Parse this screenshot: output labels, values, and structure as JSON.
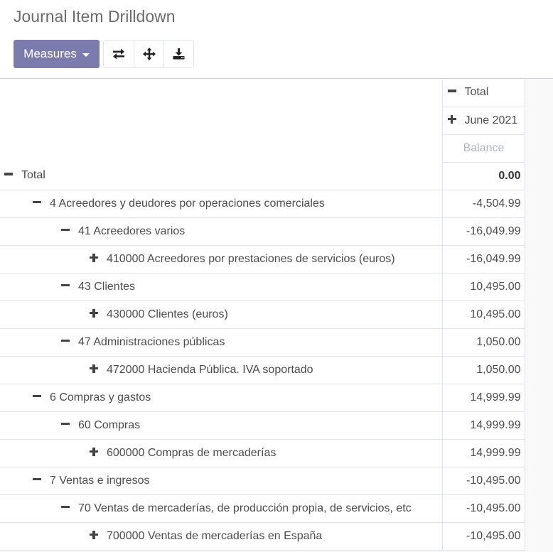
{
  "page": {
    "title": "Journal Item Drilldown"
  },
  "toolbar": {
    "measures_label": "Measures",
    "buttons": [
      {
        "icon": "exchange-icon",
        "title": "Flip axis"
      },
      {
        "icon": "arrows-icon",
        "title": "Expand all"
      },
      {
        "icon": "download-icon",
        "title": "Download xlsx"
      }
    ]
  },
  "pivot": {
    "col_headers": {
      "total": {
        "label": "Total",
        "state": "expanded"
      },
      "period": {
        "label": "June 2021",
        "state": "collapsed"
      },
      "measure": "Balance"
    },
    "rows": [
      {
        "label": "Total",
        "level": 0,
        "state": "expanded",
        "value": "0.00",
        "is_total": true
      },
      {
        "label": "4 Acreedores y deudores por operaciones comerciales",
        "level": 1,
        "state": "expanded",
        "value": "-4,504.99"
      },
      {
        "label": "41 Acreedores varios",
        "level": 2,
        "state": "expanded",
        "value": "-16,049.99"
      },
      {
        "label": "410000 Acreedores por prestaciones de servicios (euros)",
        "level": 3,
        "state": "collapsed",
        "value": "-16,049.99"
      },
      {
        "label": "43 Clientes",
        "level": 2,
        "state": "expanded",
        "value": "10,495.00"
      },
      {
        "label": "430000 Clientes (euros)",
        "level": 3,
        "state": "collapsed",
        "value": "10,495.00"
      },
      {
        "label": "47 Administraciones públicas",
        "level": 2,
        "state": "expanded",
        "value": "1,050.00"
      },
      {
        "label": "472000 Hacienda Pública. IVA soportado",
        "level": 3,
        "state": "collapsed",
        "value": "1,050.00"
      },
      {
        "label": "6 Compras y gastos",
        "level": 1,
        "state": "expanded",
        "value": "14,999.99"
      },
      {
        "label": "60 Compras",
        "level": 2,
        "state": "expanded",
        "value": "14,999.99"
      },
      {
        "label": "600000 Compras de mercaderías",
        "level": 3,
        "state": "collapsed",
        "value": "14,999.99"
      },
      {
        "label": "7 Ventas e ingresos",
        "level": 1,
        "state": "expanded",
        "value": "-10,495.00"
      },
      {
        "label": "70 Ventas de mercaderías, de producción propia, de servicios, etc",
        "level": 2,
        "state": "expanded",
        "value": "-10,495.00"
      },
      {
        "label": "700000 Ventas de mercaderías en España",
        "level": 3,
        "state": "collapsed",
        "value": "-10,495.00"
      }
    ]
  },
  "colors": {
    "primary": "#7c7bad",
    "border": "#dee2e6",
    "background": "#f9f9f9"
  }
}
